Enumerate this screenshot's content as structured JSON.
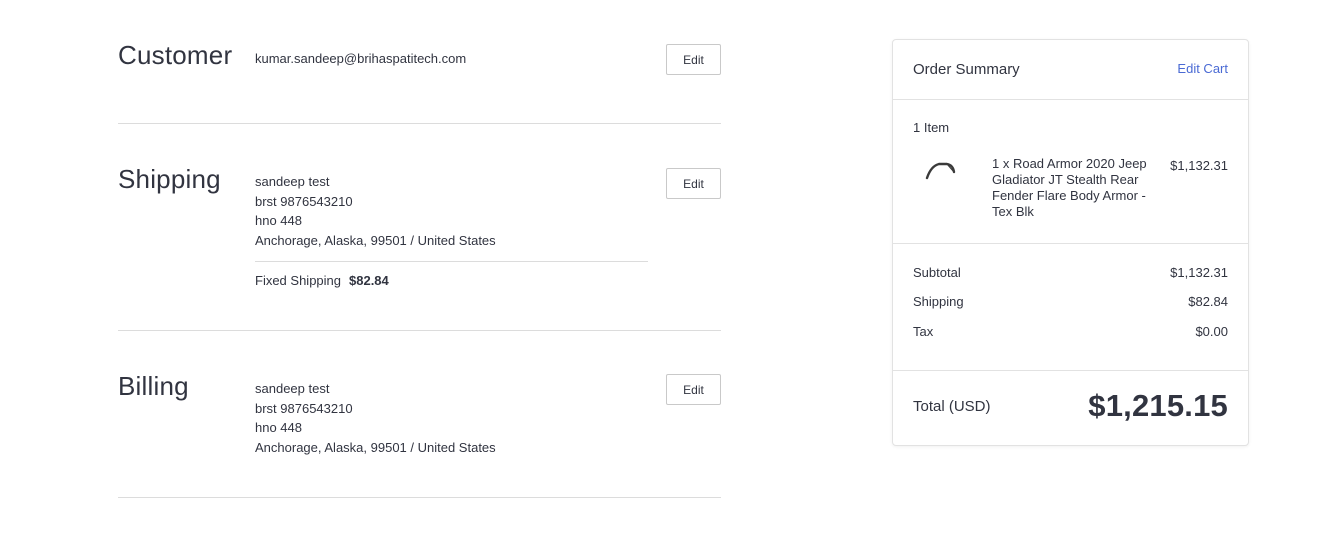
{
  "customer": {
    "title": "Customer",
    "email": "kumar.sandeep@brihaspatitech.com",
    "edit_label": "Edit"
  },
  "shipping": {
    "title": "Shipping",
    "address_lines": [
      "sandeep test",
      "brst 9876543210",
      "hno 448",
      "Anchorage, Alaska, 99501 / United States"
    ],
    "method_label": "Fixed Shipping",
    "method_price": "$82.84",
    "edit_label": "Edit"
  },
  "billing": {
    "title": "Billing",
    "address_lines": [
      "sandeep test",
      "brst 9876543210",
      "hno 448",
      "Anchorage, Alaska, 99501 / United States"
    ],
    "edit_label": "Edit"
  },
  "summary": {
    "title": "Order Summary",
    "edit_cart_label": "Edit Cart",
    "item_count": "1 Item",
    "item": {
      "name": "1 x Road Armor 2020 Jeep Gladiator JT Stealth Rear Fender Flare Body Armor - Tex Blk",
      "price": "$1,132.31",
      "icon": "fender-flare-icon"
    },
    "subtotal_label": "Subtotal",
    "subtotal_value": "$1,132.31",
    "shipping_label": "Shipping",
    "shipping_value": "$82.84",
    "tax_label": "Tax",
    "tax_value": "$0.00",
    "total_label": "Total (USD)",
    "total_value": "$1,215.15"
  },
  "colors": {
    "accent_link": "#4a6ad4",
    "text": "#313440",
    "divider": "#dcdcdc"
  }
}
